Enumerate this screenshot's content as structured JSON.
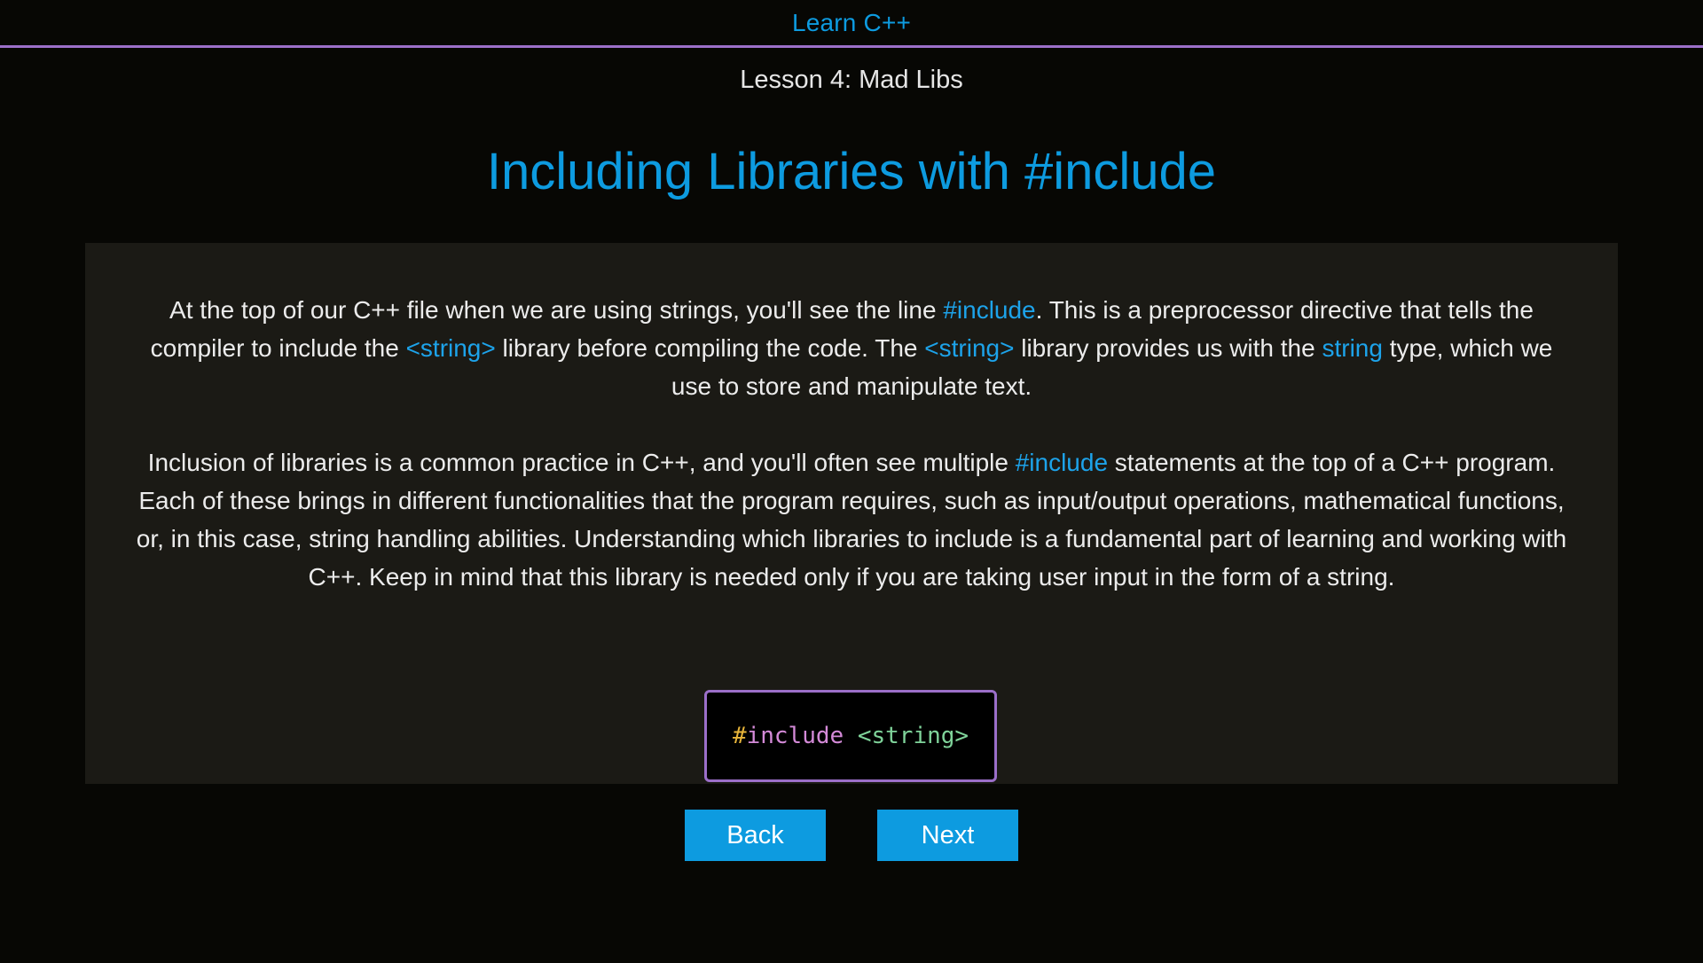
{
  "header": {
    "brand": "Learn C++",
    "accent_color": "#0d9be0",
    "divider_color": "#9b6fc9"
  },
  "lesson": {
    "label": "Lesson 4: Mad Libs"
  },
  "page": {
    "title": "Including Libraries with #include"
  },
  "content": {
    "para1": {
      "t1": "At the top of our C++ file when we are using strings, you'll see the line ",
      "k1": "#include",
      "t2": ". This is a preprocessor directive that tells the compiler to include the ",
      "k2": "<string>",
      "t3": " library before compiling the code. The ",
      "k3": "<string>",
      "t4": " library provides us with the ",
      "k4": "string",
      "t5": " type, which we use to store and manipulate text."
    },
    "para2": {
      "t1": "Inclusion of libraries is a common practice in C++, and you'll often see multiple ",
      "k1": "#include",
      "t2": " statements at the top of a C++ program. Each of these brings in different functionalities that the program requires, such as input/output operations, mathematical functions, or, in this case, string handling abilities. Understanding which libraries to include is a fundamental part of learning and working with C++. Keep in mind that this library is needed only if you are taking user input in the form of a string."
    },
    "code": {
      "hash": "#",
      "directive": "include",
      "space": " ",
      "library": "<string>"
    }
  },
  "nav": {
    "back_label": "Back",
    "next_label": "Next"
  }
}
